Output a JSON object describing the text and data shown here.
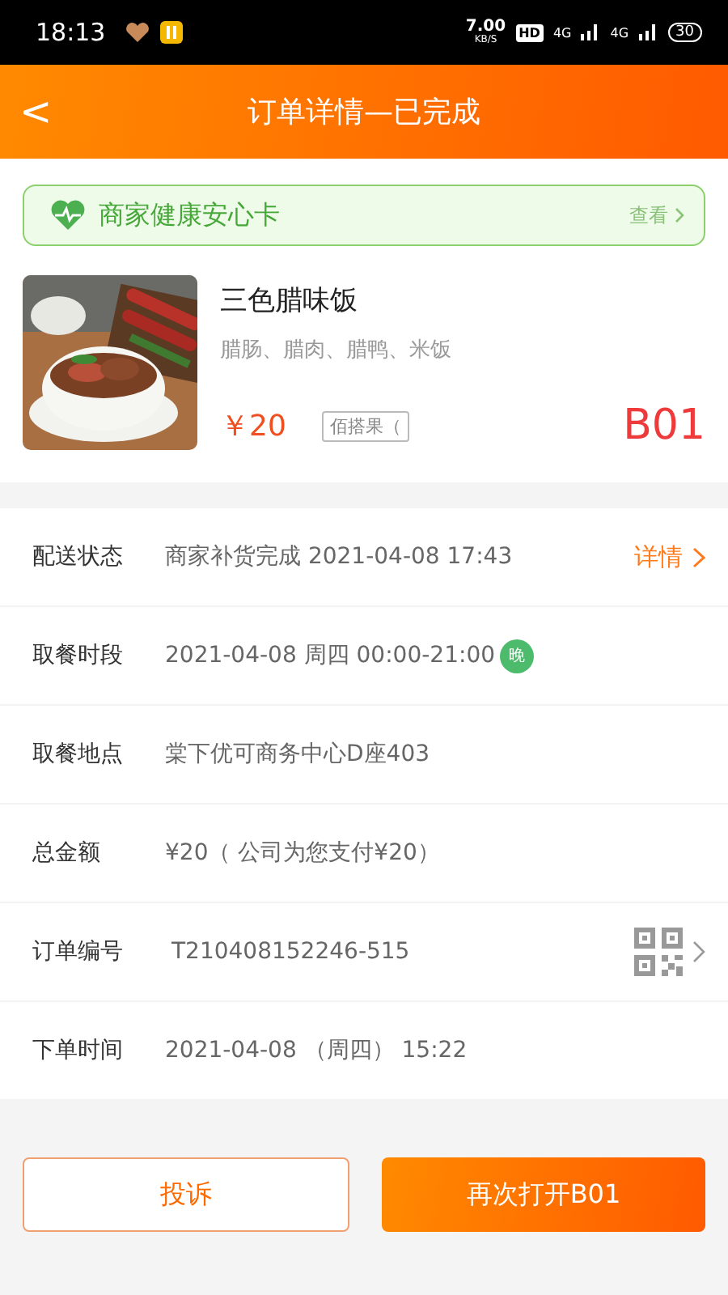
{
  "status_bar": {
    "time": "18:13",
    "speed": "7.00",
    "speed_unit": "KB/S",
    "hd": "HD",
    "network_1": "4G",
    "network_2": "4G",
    "battery": "30"
  },
  "header": {
    "back": "<",
    "title": "订单详情—已完成"
  },
  "health_card": {
    "title": "商家健康安心卡",
    "link": "查看"
  },
  "dish": {
    "kind": "picture",
    "name": "三色腊味饭",
    "ingredients": "腊肠、腊肉、腊鸭、米饭",
    "price": "￥20",
    "tag": "佰搭果（",
    "code": "B01"
  },
  "details": [
    {
      "kind": "link",
      "label": "配送状态",
      "value": "商家补货完成 2021-04-08 17:43",
      "action": "详情"
    },
    {
      "kind": "badge",
      "label": "取餐时段",
      "value": "2021-04-08 周四 00:00-21:00",
      "badge": "晚"
    },
    {
      "kind": "plain",
      "label": "取餐地点",
      "value": "棠下优可商务中心D座403"
    },
    {
      "kind": "plain",
      "label": "总金额",
      "value": "¥20（ 公司为您支付¥20）"
    },
    {
      "kind": "qr",
      "label": "订单编号",
      "value": "T210408152246-515"
    },
    {
      "kind": "plain",
      "label": "下单时间",
      "value": "2021-04-08 （周四） 15:22"
    }
  ],
  "buttons": [
    {
      "kind": "outline",
      "label": "投诉"
    },
    {
      "kind": "filled",
      "label": "再次打开B01"
    }
  ]
}
